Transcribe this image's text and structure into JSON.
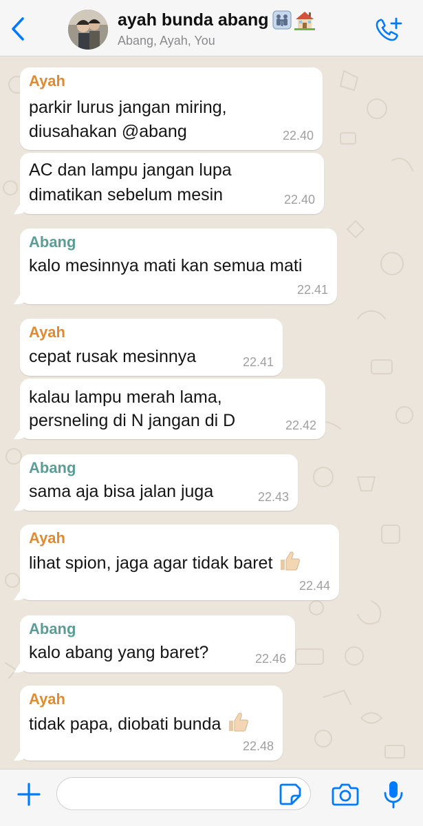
{
  "header": {
    "title": "ayah bunda abang",
    "participants": "Abang, Ayah, You",
    "title_icons": [
      "family-icon",
      "house-icon"
    ]
  },
  "accent_color": "#007aff",
  "sender_colors": {
    "Ayah": "#e08a32",
    "Abang": "#5a9d96"
  },
  "messages": [
    {
      "sender": "Ayah",
      "lines": [
        "parkir lurus jangan miring,",
        "diusahakan @abang"
      ],
      "time": "22.40"
    },
    {
      "sender": "",
      "lines": [
        "AC dan lampu jangan lupa",
        "dimatikan sebelum mesin"
      ],
      "time": "22.40"
    },
    {
      "sender": "Abang",
      "lines": [
        "kalo mesinnya mati kan semua mati"
      ],
      "time": "22.41"
    },
    {
      "sender": "Ayah",
      "lines": [
        "cepat rusak mesinnya"
      ],
      "time": "22.41"
    },
    {
      "sender": "",
      "lines": [
        "kalau lampu merah lama,",
        "persneling di N jangan di D"
      ],
      "time": "22.42"
    },
    {
      "sender": "Abang",
      "lines": [
        "sama aja bisa jalan juga"
      ],
      "time": "22.43"
    },
    {
      "sender": "Ayah",
      "lines": [
        "lihat spion, jaga agar tidak baret"
      ],
      "time": "22.44",
      "emoji": "thumbs-up-icon"
    },
    {
      "sender": "Abang",
      "lines": [
        "kalo abang yang baret?"
      ],
      "time": "22.46"
    },
    {
      "sender": "Ayah",
      "lines": [
        "tidak papa, diobati bunda"
      ],
      "time": "22.48",
      "emoji": "thumbs-up-icon"
    }
  ],
  "composer": {
    "value": "",
    "placeholder": ""
  }
}
